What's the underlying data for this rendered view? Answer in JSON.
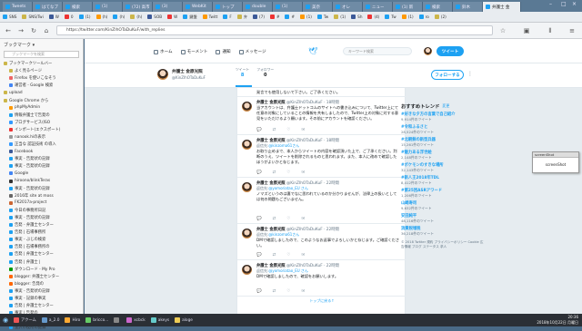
{
  "tabs": [
    {
      "label": "Tweets"
    },
    {
      "label": "はてなブ"
    },
    {
      "label": "検索"
    },
    {
      "label": "(1)"
    },
    {
      "label": "(72) 高市"
    },
    {
      "label": "(3)"
    },
    {
      "label": "WebKit"
    },
    {
      "label": "トップ"
    },
    {
      "label": "double"
    },
    {
      "label": "(1) "
    },
    {
      "label": "美奈"
    },
    {
      "label": "オレ"
    },
    {
      "label": "ニュー"
    },
    {
      "label": "(1) 新"
    },
    {
      "label": "検索"
    },
    {
      "label": "鈴木"
    },
    {
      "label": "弁護士 金"
    }
  ],
  "window": {
    "title": "弁護士 金原光 (@KinZIhOTaDuKuF)さん / Twitter - Google Chrome"
  },
  "bookmarks": [
    "SNS",
    "SNS/Twi",
    "W",
    "0",
    "(1)",
    "(h)",
    "(h)",
    "(h)",
    "SOB",
    "W",
    "鍵盤",
    "Twitt",
    "F",
    "弁",
    "(7)",
    "#",
    "#",
    "(1)",
    "Tw",
    "(1)",
    "Sh",
    "(4)",
    "Tw",
    "(1)",
    "ro",
    "(2)"
  ],
  "url": "https://twitter.com/KinZIhOTaDuKuF/with_replies",
  "sidebar": {
    "title": "ブックマーク ▾",
    "search_placeholder": "ブックマークを検索",
    "items": [
      {
        "label": "ブックマークツールバー",
        "color": "#ccb64a"
      },
      {
        "label": "よく見るページ",
        "color": "#ccb64a"
      },
      {
        "label": "Firefox を使いこなそう",
        "color": "#e66"
      },
      {
        "label": "運営者 - Google 検索",
        "color": "#4285f4"
      },
      {
        "label": "upload",
        "color": "#ccb64a"
      },
      {
        "label": "Google Chrome から",
        "color": "#ccb64a"
      },
      {
        "label": "phpMyAdmin",
        "color": "#f90"
      },
      {
        "label": "情報弁護士で告発の",
        "color": "#1da1f2"
      },
      {
        "label": "ブログサービス(ISO",
        "color": "#39f"
      },
      {
        "label": "インポート(エクスポート)",
        "color": "#e33"
      },
      {
        "label": "nanook.hiの表示",
        "color": "#999"
      },
      {
        "label": "正当な 認証技術 の導入",
        "color": "#39f"
      },
      {
        "label": "Facebook",
        "color": "#3b5998"
      },
      {
        "label": "事実 - 告発状の記録",
        "color": "#1da1f2"
      },
      {
        "label": "事実 - 告発状の記録",
        "color": "#1da1f2"
      },
      {
        "label": "Google",
        "color": "#4285f4"
      },
      {
        "label": "hiroono/blinkTeras",
        "color": "#333"
      },
      {
        "label": "事実 - 告発状の記録",
        "color": "#1da1f2"
      },
      {
        "label": "2016年 site at moss",
        "color": "#666"
      },
      {
        "label": "FK2017a-project",
        "color": "#c63"
      },
      {
        "label": "今日の事務所日記",
        "color": "#1da1f2"
      },
      {
        "label": "事実 - 告発状の記録",
        "color": "#1da1f2"
      },
      {
        "label": "告発 - 弁護士センター",
        "color": "#1da1f2"
      },
      {
        "label": "告発 | 石場事務所",
        "color": "#1da1f2"
      },
      {
        "label": "事実 - ぶじの検索",
        "color": "#1da1f2"
      },
      {
        "label": "告発 | 石場事務所の",
        "color": "#1da1f2"
      },
      {
        "label": "告発 | 弁護士センター",
        "color": "#1da1f2"
      },
      {
        "label": "告発 | 弁護士 |",
        "color": "#1da1f2"
      },
      {
        "label": "ダウンロード - My Pro",
        "color": "#090"
      },
      {
        "label": "blogger: 弁護士センター",
        "color": "#f60"
      },
      {
        "label": "blogger: 告発の",
        "color": "#f60"
      },
      {
        "label": "事実 - 告発状の記録",
        "color": "#1da1f2"
      },
      {
        "label": "事実 - 記録の事実",
        "color": "#1da1f2"
      },
      {
        "label": "告発 | 弁護士センター",
        "color": "#1da1f2"
      },
      {
        "label": "事実 | 告発の",
        "color": "#1da1f2"
      },
      {
        "label": "テストページ - hirono",
        "color": "#999"
      },
      {
        "label": "金沢市役所の記録",
        "color": "#1da1f2"
      }
    ]
  },
  "twitter": {
    "nav": [
      {
        "label": "ホーム"
      },
      {
        "label": "モーメント"
      },
      {
        "label": "通知"
      },
      {
        "label": "メッセージ"
      }
    ],
    "search_placeholder": "キーワード検索",
    "tweet_button": "ツイート",
    "profile": {
      "name": "弁護士 金原光照",
      "handle": "@KinZIhOTaDuKuF",
      "stats": [
        {
          "label": "ツイート",
          "value": "8"
        },
        {
          "label": "フォロワー",
          "value": "0"
        }
      ],
      "follow_button": "フォローする"
    },
    "tweets": [
      {
        "text": "発言でも使用しないで下さい。ご了承ください。"
      },
      {
        "name": "弁護士 金原光照",
        "handle": "@KinZIhOTaDuKuF · 18時間",
        "reply": "",
        "reply_to": "",
        "text": "当アカウントは、弁護士ドットコムのサイトへの書き込みについて、Twitter上にて任意の対象にしていることの情報を共有しましたので、Twitter上の対象に対する意見をいただけるよう願います。その前にアカウントを確認ください。"
      },
      {
        "name": "弁護士 金原光照",
        "handle": "@KinZIhOTaDuKuF · 18時間",
        "reply": "返信先:",
        "reply_to": "@kinzoma61さん",
        "text": "お取り止めまで、本人からツイートの内容を確認頂いた上で、ご了承ください。判断のうえ、ツイートを削除されるものと思われます。また、本人に改めて確認したほうがよいかと存じます。"
      },
      {
        "name": "弁護士 金原光照",
        "handle": "@KinZIhOTaDuKuF · 22時間",
        "reply": "返信先:",
        "reply_to": "@yomoriatao_EU さん",
        "text": "ノマズというのは妻でなに思われているのか分かりませんが、法律上の扱いとしては何の問題もございません。"
      },
      {
        "name": "弁護士 金原光照",
        "handle": "@KinZIhOTaDuKuF · 22時間",
        "reply": "返信先:",
        "reply_to": "@kinzoma61さん",
        "text": "DMで確認しましたので、このようなお返事でよろしいかと存じます。ご確認ください。"
      },
      {
        "name": "弁護士 金原光照",
        "handle": "@KinZIhOTaDuKuF · 22時間",
        "reply": "返信先:",
        "reply_to": "@yomoriatao_EU さん",
        "text": "DMで確認しましたので、確認をお願いします。"
      }
    ],
    "timeline_footer": "トップに戻る↑",
    "trends": {
      "title": "おすすめトレンド",
      "change": "変更",
      "items": [
        {
          "name": "#好きな夕方の言葉で自己紹介",
          "count": "9,914件のツイート"
        },
        {
          "name": "#令和ふるさと",
          "count": "28,524件のツイート"
        },
        {
          "name": "#北朝鮮の新型兵器",
          "count": "15,261件のツイート"
        },
        {
          "name": "#魅力ある浮世絵",
          "count": "2,148件のツイート"
        },
        {
          "name": "#ポケモンのすきな場所",
          "count": "32,143件のツイート"
        },
        {
          "name": "#新人王2018年TDL",
          "count": "8,412件のツイート"
        },
        {
          "name": "#第25回ASRアワード",
          "count": "1,206件のツイート"
        },
        {
          "name": "山崎寿司",
          "count": "9,632件のツイート"
        },
        {
          "name": "安田純平",
          "count": "48,116件のツイート"
        },
        {
          "name": "消費税増税",
          "count": "36,218件のツイート"
        }
      ],
      "footer": "© 2018 Twitter 規約 プライバシーポリシー Cookie 広告情報 ブログ ステータス 求人"
    }
  },
  "sticky": {
    "title": "screenShot",
    "label": "screenShot"
  },
  "taskbar": {
    "items": [
      "アクーム",
      "a_2.0",
      "Hiro",
      "bricco...",
      "",
      "xcbck",
      "akeys",
      "aloge"
    ],
    "clock_time": "20:36",
    "clock_date": "2018年10月22日 月曜日"
  }
}
